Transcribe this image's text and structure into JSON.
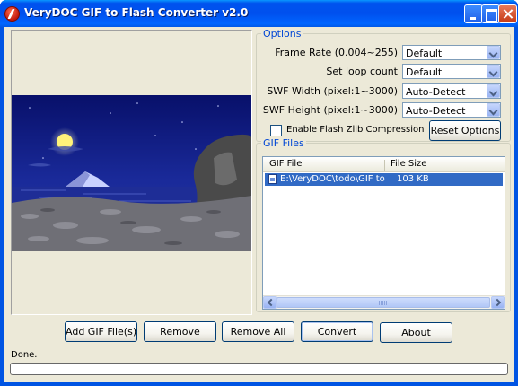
{
  "window": {
    "title": "VeryDOC GIF to Flash Converter v2.0"
  },
  "options": {
    "group_title": "Options",
    "frame_rate_label": "Frame Rate (0.004~255)",
    "frame_rate_value": "Default",
    "loop_count_label": "Set loop count",
    "loop_count_value": "Default",
    "swf_width_label": "SWF Width (pixel:1~3000)",
    "swf_width_value": "Auto-Detect",
    "swf_height_label": "SWF Height (pixel:1~3000)",
    "swf_height_value": "Auto-Detect",
    "zlib_label": "Enable Flash Zlib Compression",
    "zlib_checked": false,
    "reset_label": "Reset Options"
  },
  "files": {
    "group_title": "GIF Files",
    "columns": [
      "GIF File",
      "File Size"
    ],
    "rows": [
      {
        "file": "E:\\VeryDOC\\todo\\GIF to Fl...",
        "size": "103 KB"
      }
    ]
  },
  "buttons": {
    "add": "Add GIF File(s)",
    "remove": "Remove",
    "remove_all": "Remove All",
    "convert": "Convert",
    "about": "About"
  },
  "status": {
    "text": "Done.",
    "progress": 0
  },
  "icons": {
    "app": "app-logo-icon",
    "file": "gif-file-icon"
  },
  "colors": {
    "title_bar": "#0054e3",
    "group_title": "#0046d5",
    "selection": "#316ac5"
  }
}
